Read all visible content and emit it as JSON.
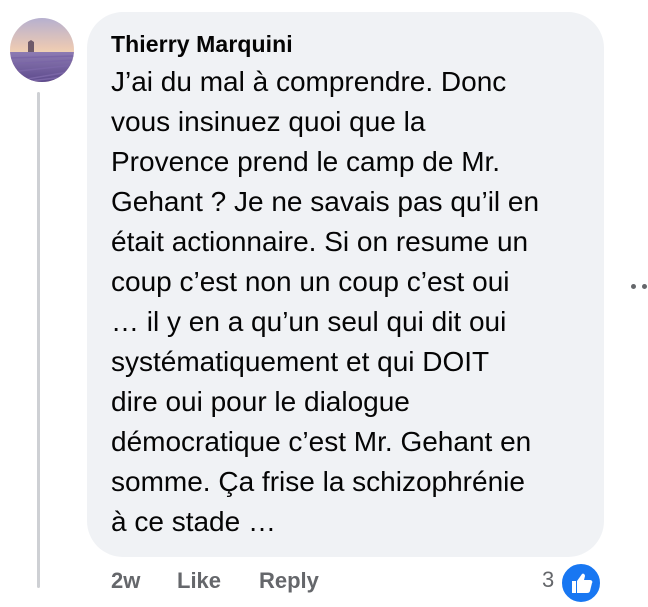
{
  "comment": {
    "author": "Thierry Marquini",
    "text_lines": [
      "J’ai du mal à comprendre. Donc",
      "vous insinuez quoi que la",
      "Provence prend le camp de Mr.",
      "Gehant ? Je ne savais pas qu’il en",
      "était actionnaire. Si on resume un",
      "coup c’est non un coup c’est oui",
      "… il y en a qu’un seul qui dit oui",
      "systématiquement et qui DOIT",
      "dire oui pour le dialogue",
      "démocratique c’est Mr. Gehant en",
      "somme. Ça frise la schizophrénie",
      "à ce stade …"
    ],
    "actions": {
      "time": "2w",
      "like": "Like",
      "reply": "Reply"
    },
    "reactions": {
      "count": "3",
      "icon": "thumbs-up-icon"
    },
    "more_icon": "more-horizontal-icon"
  },
  "colors": {
    "bubble": "#f0f2f5",
    "secondary_text": "#65676b",
    "like_blue": "#1877f2",
    "thread_line": "#ced0d4"
  }
}
